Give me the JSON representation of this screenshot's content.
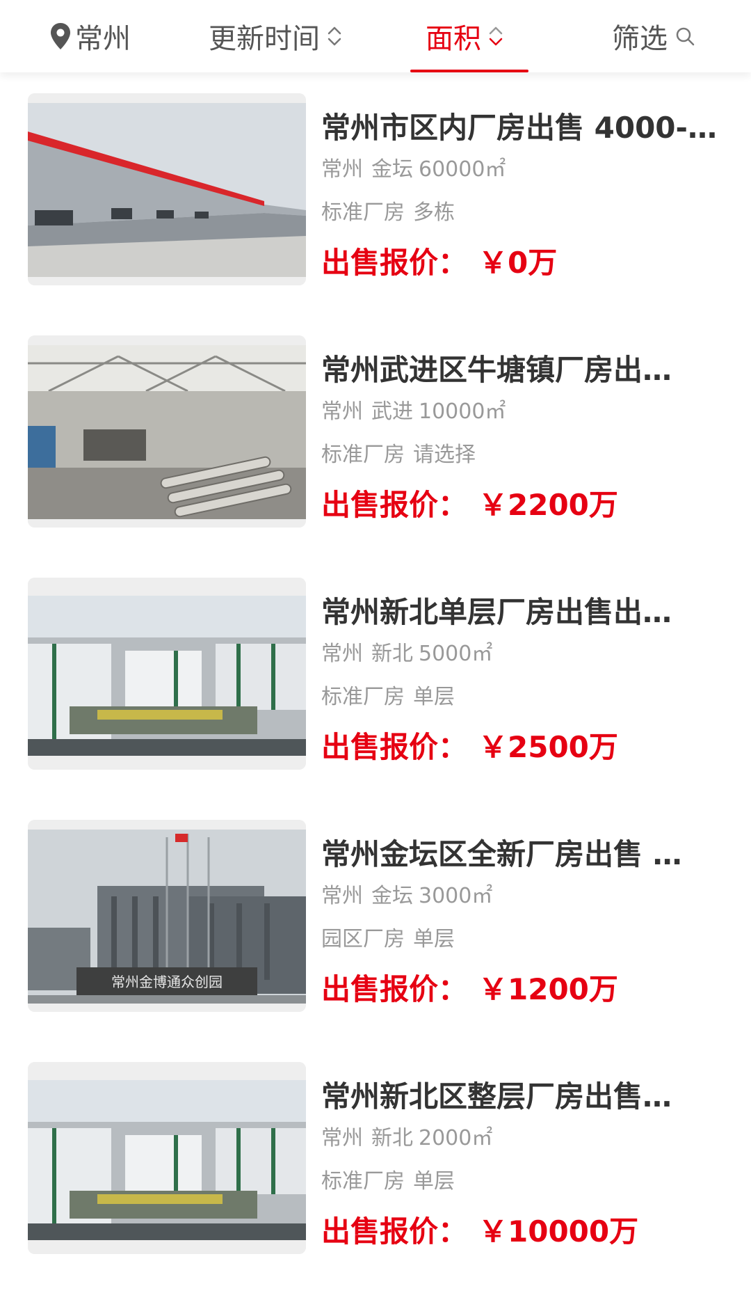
{
  "filters": {
    "city": "常州",
    "update_time": "更新时间",
    "area": "面积",
    "filter": "筛选"
  },
  "listings": [
    {
      "title": "常州市区内厂房出售 4000-…",
      "city": "常州",
      "district": "金坛",
      "area": "60000㎡",
      "type": "标准厂房",
      "floors": "多栋",
      "price_label": "出售报价：",
      "price": "￥0万"
    },
    {
      "title": "常州武进区牛塘镇厂房出…",
      "city": "常州",
      "district": "武进",
      "area": "10000㎡",
      "type": "标准厂房",
      "floors": "请选择",
      "price_label": "出售报价：",
      "price": "￥2200万"
    },
    {
      "title": "常州新北单层厂房出售出…",
      "city": "常州",
      "district": "新北",
      "area": "5000㎡",
      "type": "标准厂房",
      "floors": "单层",
      "price_label": "出售报价：",
      "price": "￥2500万"
    },
    {
      "title": "常州金坛区全新厂房出售 …",
      "city": "常州",
      "district": "金坛",
      "area": "3000㎡",
      "type": "园区厂房",
      "floors": "单层",
      "price_label": "出售报价：",
      "price": "￥1200万"
    },
    {
      "title": "常州新北区整层厂房出售…",
      "city": "常州",
      "district": "新北",
      "area": "2000㎡",
      "type": "标准厂房",
      "floors": "单层",
      "price_label": "出售报价：",
      "price": "￥10000万"
    }
  ],
  "sign_text": "常州金博通众创园",
  "colors": {
    "accent": "#e60012",
    "muted": "#999999",
    "text": "#333333"
  },
  "icons": {
    "location": "location-pin-icon",
    "sort": "sort-arrows-icon",
    "search": "search-icon"
  }
}
